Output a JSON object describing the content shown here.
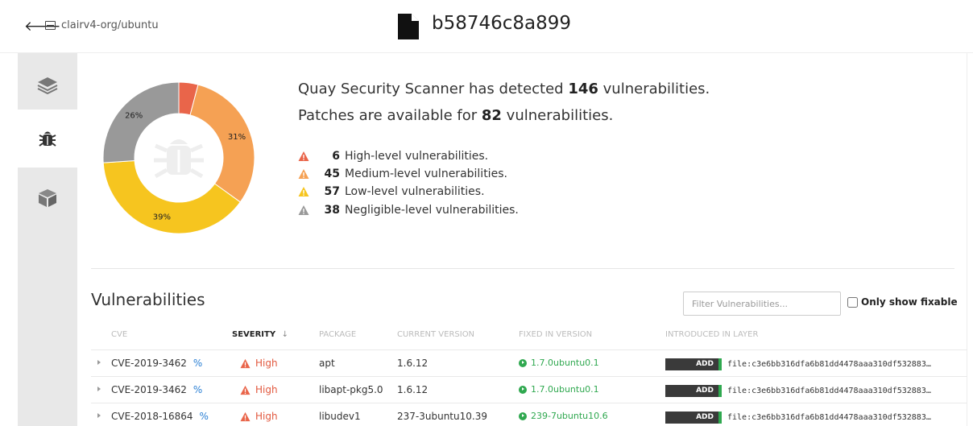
{
  "header": {
    "repo": "clairv4-org/ubuntu",
    "title": "b58746c8a899"
  },
  "tabs": [
    {
      "name": "layers",
      "icon": "layers-icon"
    },
    {
      "name": "vulnerabilities",
      "icon": "bug-icon",
      "active": true
    },
    {
      "name": "packages",
      "icon": "package-icon"
    }
  ],
  "colors": {
    "high": "#e9654a",
    "medium": "#f5a154",
    "low": "#f6c51f",
    "negligible": "#999999",
    "fixed": "#2fa84f"
  },
  "chart_data": {
    "type": "pie",
    "labels": [
      "High",
      "Medium",
      "Low",
      "Negligible"
    ],
    "values": [
      6,
      45,
      57,
      38
    ],
    "slice_labels": [
      "",
      "31%",
      "39%",
      "26%"
    ]
  },
  "summary": {
    "line1_pre": "Quay Security Scanner has detected ",
    "line1_count": "146",
    "line1_post": " vulnerabilities.",
    "line2_pre": "Patches are available for ",
    "line2_count": "82",
    "line2_post": " vulnerabilities."
  },
  "levels": [
    {
      "count": "6",
      "text": "High-level vulnerabilities."
    },
    {
      "count": "45",
      "text": "Medium-level vulnerabilities."
    },
    {
      "count": "57",
      "text": "Low-level vulnerabilities."
    },
    {
      "count": "38",
      "text": "Negligible-level vulnerabilities."
    }
  ],
  "vulnerabilities": {
    "title": "Vulnerabilities",
    "filter_placeholder": "Filter Vulnerabilities...",
    "fixable_label": "Only show fixable",
    "columns": {
      "cve": "CVE",
      "severity": "SEVERITY",
      "sort_arrow": "↓",
      "package": "PACKAGE",
      "current_version": "CURRENT VERSION",
      "fixed_in_version": "FIXED IN VERSION",
      "introduced_in_layer": "INTRODUCED IN LAYER"
    },
    "rows": [
      {
        "cve": "CVE-2019-3462",
        "severity": "High",
        "package": "apt",
        "current": "1.6.12",
        "fixed": "1.7.0ubuntu0.1",
        "layer_cmd": "ADD",
        "layer_file": "file:c3e6bb316dfa6b81dd4478aaa310df532883…"
      },
      {
        "cve": "CVE-2019-3462",
        "severity": "High",
        "package": "libapt-pkg5.0",
        "current": "1.6.12",
        "fixed": "1.7.0ubuntu0.1",
        "layer_cmd": "ADD",
        "layer_file": "file:c3e6bb316dfa6b81dd4478aaa310df532883…"
      },
      {
        "cve": "CVE-2018-16864",
        "severity": "High",
        "package": "libudev1",
        "current": "237-3ubuntu10.39",
        "fixed": "239-7ubuntu10.6",
        "layer_cmd": "ADD",
        "layer_file": "file:c3e6bb316dfa6b81dd4478aaa310df532883…"
      }
    ]
  }
}
